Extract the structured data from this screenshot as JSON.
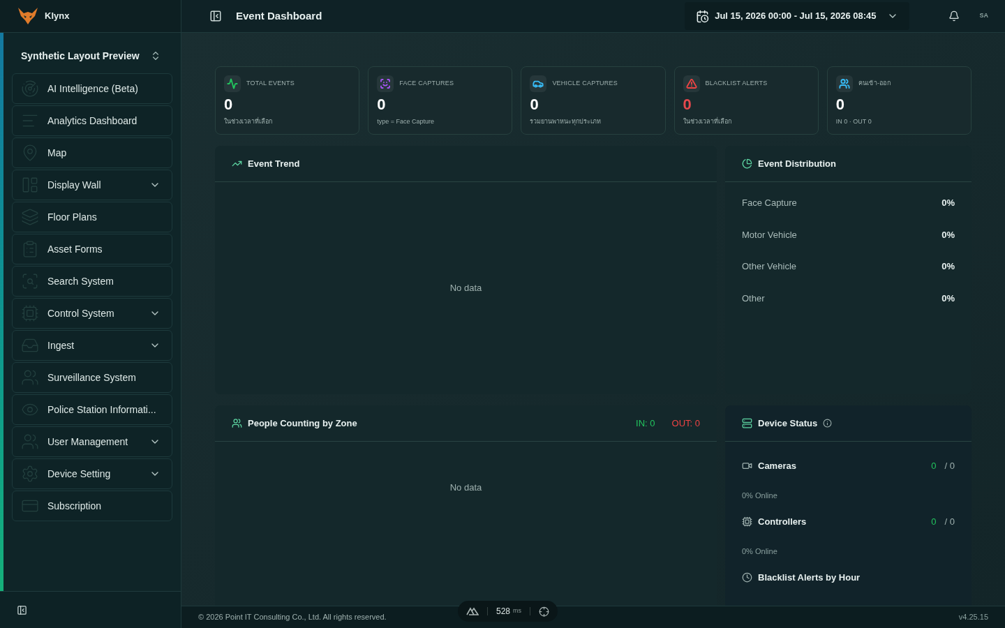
{
  "brand": {
    "name": "Klynx"
  },
  "workspace": {
    "name": "Synthetic Layout Preview"
  },
  "sidebar": {
    "items": [
      {
        "label": "AI Intelligence (Beta)",
        "has_submenu": false
      },
      {
        "label": "Analytics Dashboard",
        "has_submenu": false
      },
      {
        "label": "Map",
        "has_submenu": false
      },
      {
        "label": "Display Wall",
        "has_submenu": true
      },
      {
        "label": "Floor Plans",
        "has_submenu": false
      },
      {
        "label": "Asset Forms",
        "has_submenu": false
      },
      {
        "label": "Search System",
        "has_submenu": false
      },
      {
        "label": "Control System",
        "has_submenu": true
      },
      {
        "label": "Ingest",
        "has_submenu": true
      },
      {
        "label": "Surveillance System",
        "has_submenu": false
      },
      {
        "label": "Police Station Informati...",
        "has_submenu": false
      },
      {
        "label": "User Management",
        "has_submenu": true
      },
      {
        "label": "Device Setting",
        "has_submenu": true
      },
      {
        "label": "Subscription",
        "has_submenu": false
      }
    ]
  },
  "header": {
    "title": "Event Dashboard",
    "date_range": "Jul 15, 2026 00:00 - Jul 15, 2026 08:45",
    "avatar": "SA"
  },
  "stats": [
    {
      "label": "TOTAL EVENTS",
      "value": "0",
      "note": "ในช่วงเวลาที่เลือก",
      "color": "#22c55e",
      "alert": false
    },
    {
      "label": "FACE CAPTURES",
      "value": "0",
      "note": "type = Face Capture",
      "color": "#a855f7",
      "alert": false
    },
    {
      "label": "VEHICLE CAPTURES",
      "value": "0",
      "note": "รวมยานพาหนะทุกประเภท",
      "color": "#38bdf8",
      "alert": false
    },
    {
      "label": "BLACKLIST ALERTS",
      "value": "0",
      "note": "ในช่วงเวลาที่เลือก",
      "color": "#ef4444",
      "alert": true
    },
    {
      "label": "คนเข้า-ออก",
      "value": "0",
      "note": "IN 0 · OUT 0",
      "color": "#38bdf8",
      "alert": false
    }
  ],
  "event_trend": {
    "title": "Event Trend",
    "empty": "No data"
  },
  "event_distribution": {
    "title": "Event Distribution",
    "rows": [
      {
        "label": "Face Capture",
        "value": "0%"
      },
      {
        "label": "Motor Vehicle",
        "value": "0%"
      },
      {
        "label": "Other Vehicle",
        "value": "0%"
      },
      {
        "label": "Other",
        "value": "0%"
      }
    ]
  },
  "people_counting": {
    "title": "People Counting by Zone",
    "in": "IN: 0",
    "out": "OUT: 0",
    "empty": "No data"
  },
  "device_status": {
    "title": "Device Status",
    "rows": [
      {
        "name": "Cameras",
        "online": "0",
        "total": "/ 0",
        "note": "0% Online"
      },
      {
        "name": "Controllers",
        "online": "0",
        "total": "/ 0",
        "note": "0% Online"
      }
    ],
    "next_section": "Blacklist Alerts by Hour"
  },
  "footer": {
    "copyright": "© 2026 Point IT Consulting Co., Ltd. All rights reserved.",
    "latency": "528",
    "latency_unit": "ms",
    "version": "v4.25.15"
  }
}
